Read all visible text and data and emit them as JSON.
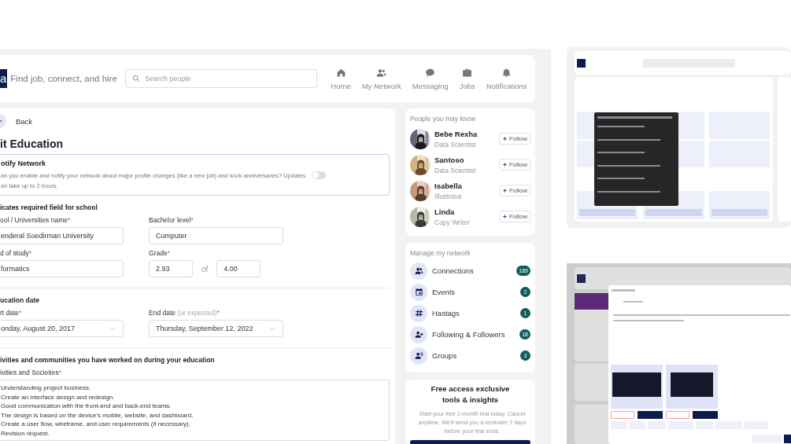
{
  "header": {
    "logo": "a",
    "tagline": "Find job, connect, and hire",
    "search": {
      "placeholder": "Search people"
    },
    "nav": [
      {
        "kind": "home",
        "label": "Home"
      },
      {
        "kind": "people",
        "label": "My Network"
      },
      {
        "kind": "chat",
        "label": "Messaging"
      },
      {
        "kind": "briefcase",
        "label": "Jobs"
      },
      {
        "kind": "bell",
        "label": "Notifications"
      }
    ]
  },
  "form": {
    "back": "Back",
    "title": "it Education",
    "notify": {
      "title": "otify Network",
      "lines": [
        "an you enable and notify your network about major profile changes (like a new job) and work anniversaries? Updates",
        "an take up to 2 hours."
      ],
      "on": false
    },
    "sections": [
      {
        "heading": "icates required field for school",
        "rows": [
          [
            {
              "kind": "text",
              "label": "ool / Universities name",
              "mark": "*",
              "value": "enderal Soedirman University"
            },
            {
              "kind": "text",
              "label": "Bachelor level",
              "mark": "*",
              "value": "Computer"
            }
          ],
          [
            {
              "kind": "text",
              "label": "d of study",
              "mark": "*",
              "value": "formatics"
            },
            {
              "kind": "grade",
              "label": "Grade",
              "mark": "*",
              "value": "2.93",
              "joiner": "of",
              "max": "4.00"
            }
          ]
        ]
      },
      {
        "heading": "ucation date",
        "rows": [
          [
            {
              "kind": "date",
              "label": "rt date",
              "mark": "*",
              "value": "onday, August 20, 2017"
            },
            {
              "kind": "date",
              "label": "End date",
              "hint": "(or expected)",
              "mark": "*",
              "value": "Thursday, September 12, 2022"
            }
          ]
        ]
      },
      {
        "heading": "ivities and communities you have worked on during your education",
        "rows": [
          [
            {
              "kind": "textarea",
              "label": "ivities and Societies",
              "mark": "*",
              "lines": [
                "Understanding project business.",
                "Create an interface design and redesign.",
                "Good communication with the front-end and back-end teams.",
                "The design is based on the device's mobile, website, and dashboard.",
                "Create a user flow, wireframe, and user requirements (if necessary).",
                "Revision request."
              ]
            }
          ]
        ]
      }
    ]
  },
  "people": {
    "title": "People you may know",
    "items": [
      {
        "name": "Bebe Rexha",
        "role": "Data Scientist",
        "action": "Follow"
      },
      {
        "name": "Santoso",
        "role": "Data Scientist",
        "action": "Follow"
      },
      {
        "name": "Isabella",
        "role": "Illustrator",
        "action": "Follow"
      },
      {
        "name": "Linda",
        "role": "Copy Writer",
        "action": "Follow"
      }
    ]
  },
  "network": {
    "title": "Manage my network",
    "items": [
      {
        "kind": "people",
        "label": "Connections",
        "count": "189"
      },
      {
        "kind": "calendar",
        "label": "Events",
        "count": "2"
      },
      {
        "kind": "hash",
        "label": "Hastags",
        "count": "1"
      },
      {
        "kind": "person-add",
        "label": "Following & Followers",
        "count": "18"
      },
      {
        "kind": "group",
        "label": "Groups",
        "count": "3"
      }
    ]
  },
  "promo": {
    "title": "Free access exclusive tools & insights",
    "text": "Start your free 1-month trial today. Cancel anytime. We'll send you a reminder 7 days before your trial ends."
  }
}
